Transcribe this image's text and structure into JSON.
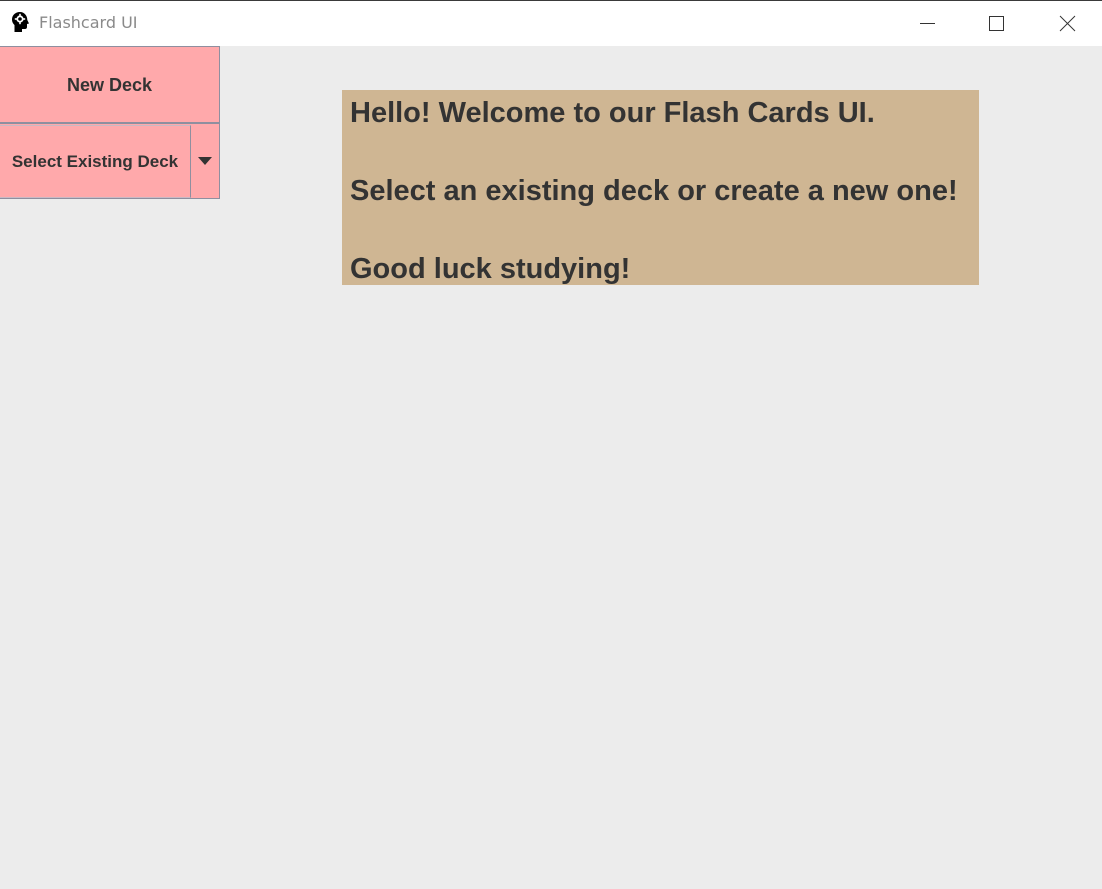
{
  "window": {
    "title": "Flashcard UI",
    "app_icon": "head-gear-icon",
    "controls": [
      "minimize-icon",
      "maximize-icon",
      "close-icon"
    ]
  },
  "sidebar": {
    "new_deck_label": "New Deck",
    "select_deck": {
      "selected_label": "Select Existing Deck",
      "arrow_icon": "triangle-down-icon"
    }
  },
  "welcome": {
    "line1": "Hello! Welcome to our Flash Cards UI.",
    "line2": "",
    "line3": "Select an existing deck or create a new one!",
    "line4": "",
    "line5": "Good luck studying!"
  },
  "colors": {
    "button_bg": "#ffa9ab",
    "message_bg": "#cfb693",
    "window_bg": "#ececec",
    "text": "#333333"
  }
}
